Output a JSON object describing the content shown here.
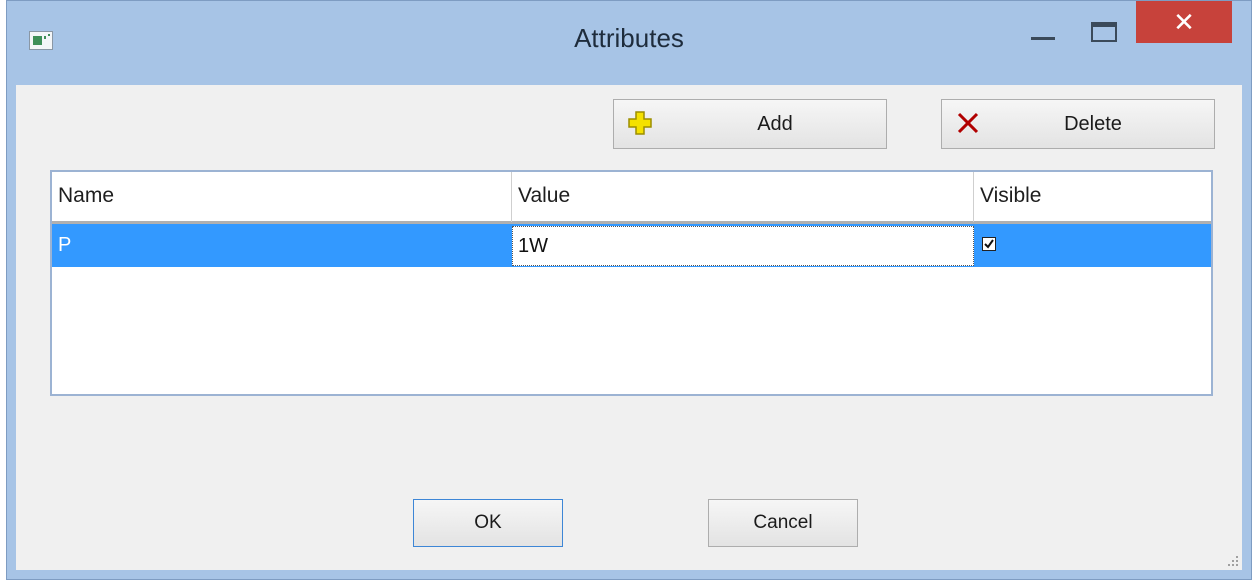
{
  "window": {
    "title": "Attributes",
    "close_glyph": "✕"
  },
  "toolbar": {
    "add_label": "Add",
    "delete_label": "Delete"
  },
  "table": {
    "columns": [
      "Name",
      "Value",
      "Visible"
    ],
    "rows": [
      {
        "name": "P",
        "value": "1W",
        "visible": true
      }
    ]
  },
  "footer": {
    "ok_label": "OK",
    "cancel_label": "Cancel"
  },
  "colors": {
    "selection": "#3399ff",
    "close_button": "#c7423b",
    "add_icon": "#f5e100",
    "delete_icon": "#b10000"
  },
  "icons": [
    "app-icon",
    "plus-icon",
    "x-icon",
    "checkmark-icon",
    "resize-grip-icon"
  ]
}
